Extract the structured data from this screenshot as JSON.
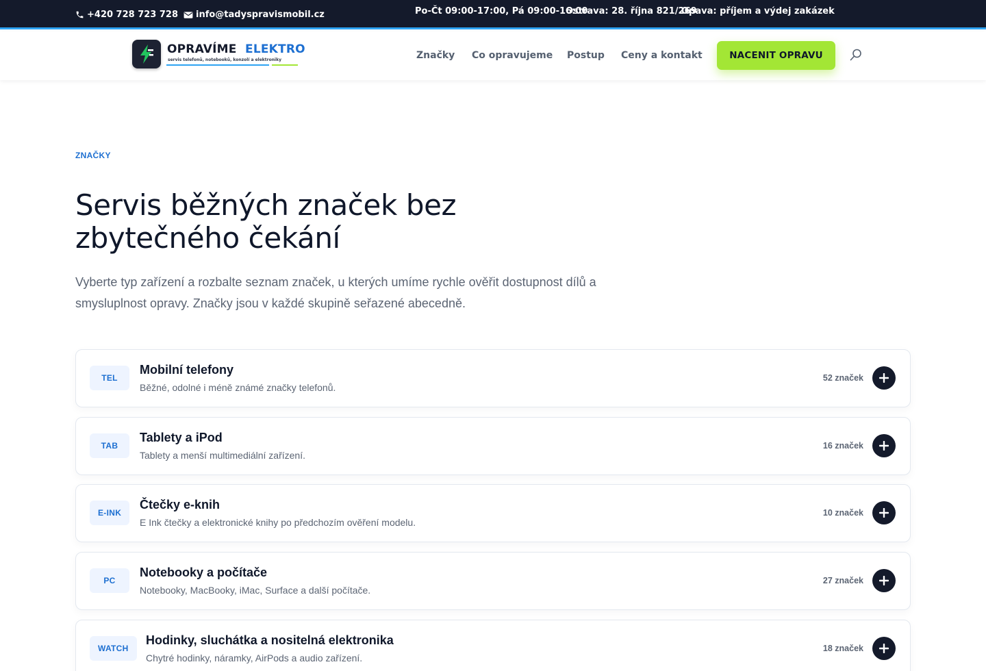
{
  "topbar": {
    "phone": "+420 728 723 728",
    "email": "info@tadyspravismobil.cz",
    "hours": "Po-Čt 09:00-17:00, Pá 09:00-16:00",
    "address_ostrava": "Ostrava: 28. října 821/269",
    "address_opava": "Opava: příjem a výdej zakázek"
  },
  "logo": {
    "word1": "OPRAVÍME",
    "word2": "ELEKTRO",
    "tagline": "servis telefonů, notebooků, konzolí a elektroniky"
  },
  "nav": {
    "items": [
      {
        "label": "Značky"
      },
      {
        "label": "Co opravujeme"
      },
      {
        "label": "Postup"
      },
      {
        "label": "Ceny a kontakt"
      }
    ],
    "cta": "NACENIT OPRAVU"
  },
  "hero": {
    "eyebrow": "ZNAČKY",
    "title": "Servis běžných značek bez zbytečného čekání",
    "lead": "Vyberte typ zařízení a rozbalte seznam značek, u kterých umíme rychle ověřit dostupnost dílů a smysluplnost opravy. Značky jsou v každé skupině seřazené abecedně."
  },
  "categories": [
    {
      "badge": "TEL",
      "title": "Mobilní telefony",
      "desc": "Běžné, odolné i méně známé značky telefonů.",
      "count": "52 značek"
    },
    {
      "badge": "TAB",
      "title": "Tablety a iPod",
      "desc": "Tablety a menší multimediální zařízení.",
      "count": "16 značek"
    },
    {
      "badge": "E-INK",
      "title": "Čtečky e-knih",
      "desc": "E Ink čtečky a elektronické knihy po předchozím ověření modelu.",
      "count": "10 značek"
    },
    {
      "badge": "PC",
      "title": "Notebooky a počítače",
      "desc": "Notebooky, MacBooky, iMac, Surface a další počítače.",
      "count": "27 značek"
    },
    {
      "badge": "WATCH",
      "title": "Hodinky, sluchátka a nositelná elektronika",
      "desc": "Chytré hodinky, náramky, AirPods a audio zařízení.",
      "count": "18 značek"
    }
  ],
  "colors": {
    "topbar_bg": "#141a2b",
    "accent_blue": "#1d6fd1",
    "cta_green": "#a3e635"
  }
}
